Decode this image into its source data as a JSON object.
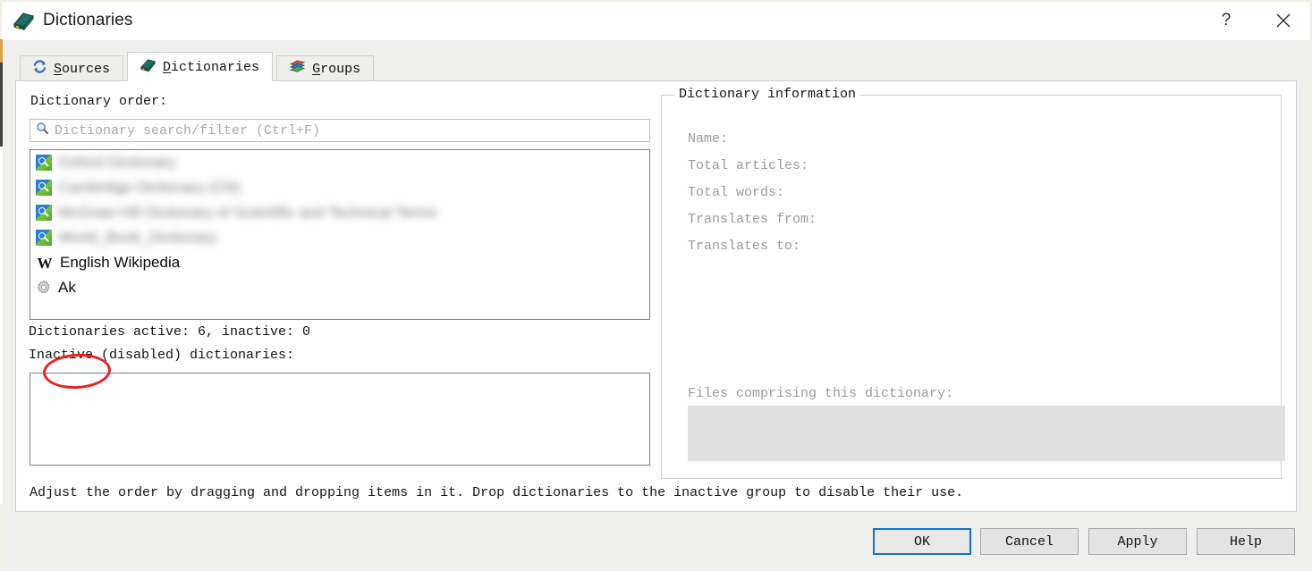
{
  "window": {
    "title": "Dictionaries",
    "icon": "book-icon",
    "help_button": "?",
    "close_button": "✕"
  },
  "tabs": [
    {
      "id": "sources",
      "label": "Sources",
      "accel": "S",
      "icon": "refresh-icon",
      "active": false
    },
    {
      "id": "dictionaries",
      "label": "Dictionaries",
      "accel": "D",
      "icon": "book-icon",
      "active": true
    },
    {
      "id": "groups",
      "label": "Groups",
      "accel": "G",
      "icon": "books-stack-icon",
      "active": false
    }
  ],
  "left": {
    "order_label": "Dictionary order:",
    "search": {
      "placeholder": "Dictionary search/filter (Ctrl+F)",
      "value": "",
      "icon": "search-icon"
    },
    "dictionaries": [
      {
        "name": "Oxford Dictionary",
        "icon": "dictionary-icon",
        "redacted": true
      },
      {
        "name": "Cambridge Dictionary (CN)",
        "icon": "dictionary-icon",
        "redacted": true
      },
      {
        "name": "McGraw-Hill Dictionary of Scientific and Technical Terms",
        "icon": "dictionary-icon",
        "redacted": true
      },
      {
        "name": "World_Book_Dictionary",
        "icon": "dictionary-icon",
        "redacted": true
      },
      {
        "name": "English Wikipedia",
        "icon": "wikipedia-icon",
        "redacted": false
      },
      {
        "name": "Ak",
        "icon": "gear-icon",
        "redacted": false,
        "annotated": true
      }
    ],
    "status": "Dictionaries active: 6, inactive: 0",
    "inactive_label": "Inactive (disabled) dictionaries:",
    "inactive_items": [],
    "hint": "Adjust the order by dragging and dropping items in it. Drop dictionaries to the inactive group to disable their use."
  },
  "right": {
    "group_title": "Dictionary information",
    "fields": [
      {
        "label": "Name:",
        "value": ""
      },
      {
        "label": "Total articles:",
        "value": ""
      },
      {
        "label": "Total words:",
        "value": ""
      },
      {
        "label": "Translates from:",
        "value": ""
      },
      {
        "label": "Translates to:",
        "value": ""
      }
    ],
    "files_label": "Files comprising this dictionary:",
    "files_value": ""
  },
  "footer": {
    "ok": "OK",
    "cancel": "Cancel",
    "apply": "Apply",
    "help": "Help"
  },
  "colors": {
    "accent": "#1573c8",
    "annotation": "#e8231f",
    "panel_bg": "#ffffff",
    "window_bg": "#efefee",
    "disabled_text": "#9a9a9a",
    "disabled_field": "#e0e0e0"
  }
}
